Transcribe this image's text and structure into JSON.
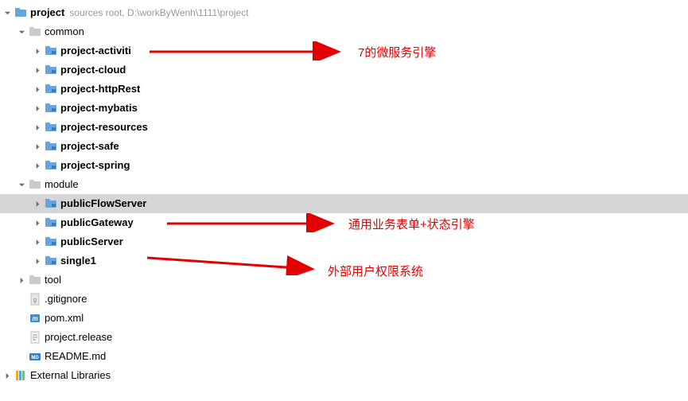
{
  "root": {
    "name": "project",
    "path_label": "sources root,  D:\\workByWenh\\1111\\project"
  },
  "common": {
    "name": "common",
    "items": [
      {
        "label": "project-activiti"
      },
      {
        "label": "project-cloud"
      },
      {
        "label": "project-httpRest"
      },
      {
        "label": "project-mybatis"
      },
      {
        "label": "project-resources"
      },
      {
        "label": "project-safe"
      },
      {
        "label": "project-spring"
      }
    ]
  },
  "module": {
    "name": "module",
    "items": [
      {
        "label": "publicFlowServer"
      },
      {
        "label": "publicGateway"
      },
      {
        "label": "publicServer"
      },
      {
        "label": "single1"
      }
    ]
  },
  "tool": {
    "name": "tool"
  },
  "files": {
    "gitignore": ".gitignore",
    "pom": "pom.xml",
    "release": "project.release",
    "readme": "README.md"
  },
  "external_libs": "External Libraries",
  "annotations": {
    "a1": "7的微服务引擎",
    "a2": "通用业务表单+状态引擎",
    "a3": "外部用户权限系统"
  }
}
